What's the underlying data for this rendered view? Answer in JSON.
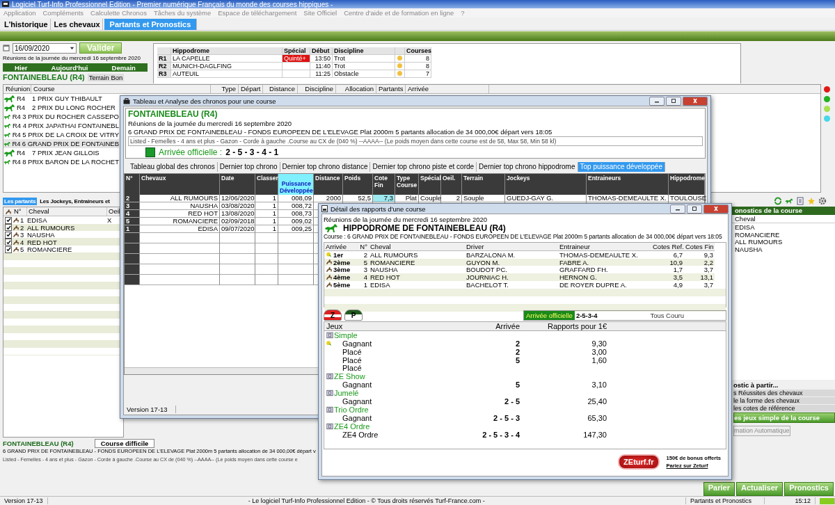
{
  "app": {
    "title": "Logiciel Turf-Info Professionnel Edition - Premier numérique Français du monde des courses hippiques -",
    "menu": [
      "Application",
      "Compléments",
      "Calculette Chronos",
      "Tâches du système",
      "Espace de téléchargement",
      "Site Officiel",
      "Centre d'aide et de formation en ligne",
      "?"
    ],
    "tabs": [
      {
        "label": "L'historique",
        "selected": false
      },
      {
        "label": "Les chevaux",
        "selected": false
      },
      {
        "label": "Partants et Pronostics",
        "selected": true
      }
    ]
  },
  "day": {
    "date": "16/09/2020",
    "validate": "Valider",
    "caption": "Réunions de la journée du mercredi 16 septembre 2020",
    "nav": [
      "Hier",
      "Aujourd'hui",
      "Demain"
    ],
    "meeting": "FONTAINEBLEAU (R4)",
    "ground": "Terrain Bon"
  },
  "meetings": {
    "columns": [
      "Hippodrome",
      "Spécial",
      "Début",
      "Discipline",
      "Courses"
    ],
    "rows": [
      {
        "id": "R1",
        "name": "LA CAPELLE",
        "special": "Quinté+",
        "start": "13:50",
        "discipline": "Trot",
        "count": "8"
      },
      {
        "id": "R2",
        "name": "MUNICH-DAGLFING",
        "start": "11:40",
        "discipline": "Trot",
        "count": "8"
      },
      {
        "id": "R3",
        "name": "AUTEUIL",
        "start": "11:25",
        "discipline": "Obstacle",
        "count": "7"
      }
    ]
  },
  "races": {
    "columns": [
      "Réunion",
      "Course",
      "Type",
      "Départ",
      "Distance",
      "Discipline",
      "Allocation",
      "Partants",
      "Arrivée"
    ],
    "rows": [
      {
        "meeting": "R4",
        "course": "1 PRIX GUY THIBAULT",
        "selected": false
      },
      {
        "meeting": "R4",
        "course": "2 PRIX DU LONG ROCHER",
        "selected": false
      },
      {
        "meeting": "R4",
        "course": "3 PRIX DU ROCHER CASSEPO",
        "selected": false
      },
      {
        "meeting": "R4",
        "course": "4 PRIX JAPATHAI FONTAINEBL",
        "selected": false
      },
      {
        "meeting": "R4",
        "course": "5 PRIX DE LA CROIX DE VITRY",
        "selected": false
      },
      {
        "meeting": "R4",
        "course": "6 GRAND PRIX DE FONTAINEB",
        "selected": true
      },
      {
        "meeting": "R4",
        "course": "7 PRIX JEAN GILLOIS",
        "selected": false
      },
      {
        "meeting": "R4",
        "course": "8 PRIX BARON DE LA ROCHET",
        "selected": false
      }
    ]
  },
  "status_dots": [
    {
      "color": "#e01818"
    },
    {
      "color": "#22b022"
    },
    {
      "color": "#a8e050"
    },
    {
      "color": "#48d8e8"
    }
  ],
  "lower_tabs": [
    {
      "label": "Les partants",
      "selected": true
    },
    {
      "label": "Les Jockeys, Entraineurs et",
      "selected": false
    }
  ],
  "runners": {
    "columns": [
      "N°",
      "Cheval",
      "Oeil"
    ],
    "rows": [
      {
        "num": "1",
        "name": "EDISA",
        "eye": "X",
        "checked": true
      },
      {
        "num": "2",
        "name": "ALL RUMOURS",
        "checked": true
      },
      {
        "num": "3",
        "name": "NAUSHA",
        "checked": true
      },
      {
        "num": "4",
        "name": "RED HOT",
        "checked": true
      },
      {
        "num": "5",
        "name": "ROMANCIERE",
        "checked": true
      }
    ]
  },
  "forecast": {
    "title": "onostics de la course",
    "column": "Cheval",
    "horses": [
      "EDISA",
      "ROMANCIERE",
      "ALL RUMOURS",
      "NAUSHA"
    ]
  },
  "forecast_options": {
    "title": "ostic à partir...",
    "items": [
      "s Réussites des chevaux",
      "le la forme des chevaux",
      "les cotes de référence"
    ],
    "action": "es jeux simple de la course",
    "auto": "mation Automatique"
  },
  "race_info": {
    "meeting": "FONTAINEBLEAU (R4)",
    "difficulty": "Course difficile",
    "line": "6 GRAND PRIX DE FONTAINEBLEAU - FONDS EUROPEEN DE L'ELEVAGE Plat 2000m 5 partants allocation de 34 000,00€ départ v",
    "conditions": "Listed - Femelles - 4 ans et plus - Gazon - Corde à gauche .Course au CX de (040 %)  --AAAA--  (Le poids moyen dans cette course e"
  },
  "actions": [
    "Parier",
    "Actualiser",
    "Pronostics"
  ],
  "status_bar": {
    "version": "Version 17-13",
    "copyright": "- Le logiciel Turf-Info Professionnel Edition - © Tous droits réservés Turf-France.com -",
    "section": "Partants et Pronostics",
    "time": "15:12"
  },
  "chrono_window": {
    "title": "Tableau et Analyse des chronos pour une course",
    "meeting": "FONTAINEBLEAU (R4)",
    "caption": "Réunions de la journée du mercredi 16 septembre 2020",
    "race": "6 GRAND PRIX DE FONTAINEBLEAU - FONDS EUROPEEN DE L'ELEVAGE Plat 2000m 5 partants allocation de 34 000,00€ départ vers 18:05",
    "conditions": "Listed - Femelles - 4 ans et plus - Gazon - Corde à gauche .Course au CX de (040 %)  --AAAA--  (Le poids moyen dans cette course est de 58, Max 58, Min 58 kl)",
    "arrival_label": "Arrivée officielle :",
    "arrival": "2 - 5 - 3 - 4 - 1",
    "tabs": [
      {
        "label": "Tableau global des chronos",
        "selected": false
      },
      {
        "label": "Dernier top chrono",
        "selected": false
      },
      {
        "label": "Dernier top chrono distance",
        "selected": false
      },
      {
        "label": "Dernier top chrono piste et corde",
        "selected": false
      },
      {
        "label": "Dernier top chrono hippodrome",
        "selected": false
      },
      {
        "label": "Top puissance développée",
        "selected": true
      }
    ],
    "columns": [
      "N°",
      "Chevaux",
      "Date",
      "Classer",
      "Puissance Développée",
      "Distance",
      "Poids",
      "Cote Fin",
      "Type Course",
      "Spécial",
      "Oeil.",
      "Terrain",
      "Jockeys",
      "Entraineurs",
      "Hippodrome"
    ],
    "rows": [
      [
        "2",
        "ALL RUMOURS",
        "12/06/2020",
        "1",
        "008,09",
        "2000",
        "52,5",
        "7,3",
        "Plat",
        "Couple",
        "2",
        "Souple",
        "GUEDJ-GAY G.",
        "THOMAS-DEMEAULTE X.",
        "TOULOUSE"
      ],
      [
        "3",
        "NAUSHA",
        "03/08/2020",
        "1",
        "008,72"
      ],
      [
        "4",
        "RED HOT",
        "13/08/2020",
        "1",
        "008,73"
      ],
      [
        "5",
        "ROMANCIERE",
        "02/09/2018",
        "1",
        "009,02"
      ],
      [
        "1",
        "EDISA",
        "09/07/2020",
        "1",
        "009,25"
      ]
    ],
    "version": "Version 17-13"
  },
  "detail_window": {
    "title": "Détail des rapports d'une course",
    "caption": "Réunions de la journée du mercredi 16 septembre 2020",
    "hippodrome": "HIPPODROME DE  FONTAINEBLEAU (R4)",
    "race": "Course : 6 GRAND PRIX DE FONTAINEBLEAU - FONDS EUROPEEN DE L'ELEVAGE Plat 2000m 5 partants allocation de 34 000,00€ départ vers 18:05",
    "columns": [
      "Arrivée",
      "N°",
      "Cheval",
      "Driver",
      "Entraineur",
      "Cotes Ref.",
      "Cotes Fin"
    ],
    "rows": [
      {
        "kind": "winner",
        "place": "1er",
        "num": "2",
        "horse": "ALL RUMOURS",
        "driver": "BARZALONA M.",
        "trainer": "THOMAS-DEMEAULTE X.",
        "ref": "6,7",
        "fin": "9,3"
      },
      {
        "kind": "placed",
        "place": "2ème",
        "num": "5",
        "horse": "ROMANCIERE",
        "driver": "GUYON M.",
        "trainer": "FABRE A.",
        "ref": "10,9",
        "fin": "2,2"
      },
      {
        "kind": "placed",
        "place": "3ème",
        "num": "3",
        "horse": "NAUSHA",
        "driver": "BOUDOT PC.",
        "trainer": "GRAFFARD FH.",
        "ref": "1,7",
        "fin": "3,7"
      },
      {
        "kind": "placed",
        "place": "4ème",
        "num": "4",
        "horse": "RED HOT",
        "driver": "JOURNIAC H.",
        "trainer": "HERNON G.",
        "ref": "3,5",
        "fin": "13,1"
      },
      {
        "kind": "placed",
        "place": "5ème",
        "num": "1",
        "horse": "EDISA",
        "driver": "BACHELOT T.",
        "trainer": "DE ROYER DUPRE A.",
        "ref": "4,9",
        "fin": "3,7"
      }
    ],
    "z_button": "Z",
    "p_button": "P",
    "arrival_label": "Arrivée officielle",
    "arrival": "2-5-3-4",
    "runners_note": "Tous Couru",
    "bets_columns": [
      "Jeux",
      "Arrivée",
      "Rapports pour 1€"
    ],
    "bets": [
      {
        "name": "Simple",
        "children": [
          {
            "label": "Gagnant",
            "arrival": "2",
            "payout": "9,30",
            "marked": true
          },
          {
            "label": "Placé",
            "arrival": "2",
            "payout": "3,00",
            "marked": false
          },
          {
            "label": "Placé",
            "arrival": "5",
            "payout": "1,60",
            "marked": false
          },
          {
            "label": "Placé",
            "marked": false
          }
        ]
      },
      {
        "name": "ZE Show",
        "children": [
          {
            "label": "Gagnant",
            "arrival": "5",
            "payout": "3,10",
            "marked": false
          }
        ]
      },
      {
        "name": "Jumelé",
        "children": [
          {
            "label": "Gagnant",
            "arrival": "2 - 5",
            "payout": "25,40",
            "marked": false
          }
        ]
      },
      {
        "name": "Trio Ordre",
        "children": [
          {
            "label": "Gagnant",
            "arrival": "2 - 5 - 3",
            "payout": "65,30",
            "marked": false
          }
        ]
      },
      {
        "name": "ZE4 Ordre",
        "children": [
          {
            "label": "ZE4 Ordre",
            "arrival": "2 - 5 - 3 - 4",
            "payout": "147,30",
            "marked": false
          }
        ]
      }
    ],
    "logo": "ZEturf.fr",
    "bonus": "150€ de bonus offerts",
    "bet_link": "Pariez sur Zeturf"
  }
}
